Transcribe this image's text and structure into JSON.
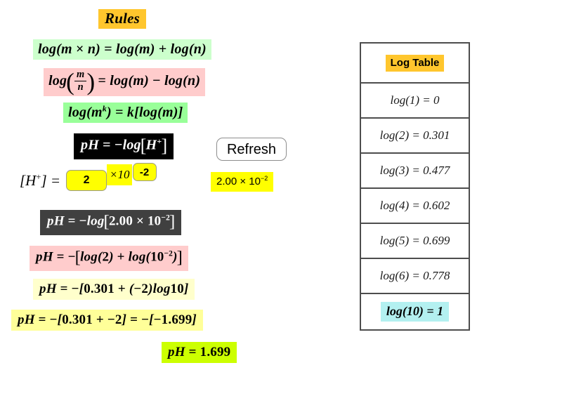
{
  "title": "Rules",
  "rules": [
    {
      "id": "product",
      "text": "log(m × n) = log(m) + log(n)",
      "color": "#CCFFCC"
    },
    {
      "id": "quotient",
      "text": "log(m/n) = log(m) − log(n)",
      "color": "#FFCCCC"
    },
    {
      "id": "power",
      "text": "log(m^k) = k[log(m)]",
      "color": "#99FF99"
    }
  ],
  "ph_definition": "pH = −log[H⁺]",
  "input": {
    "concentration_label": "[H⁺] =",
    "mantissa_value": "2",
    "times_ten_label": "×10",
    "exponent_value": "-2",
    "scientific_result": "2.00 × 10⁻²"
  },
  "refresh_label": "Refresh",
  "steps": [
    {
      "id": "substitute",
      "text": "pH = −log[2.00 × 10⁻²]",
      "color": "#404040"
    },
    {
      "id": "split",
      "text": "pH = −[log(2) + log(10⁻²)]",
      "color": "#FFCCCC"
    },
    {
      "id": "values",
      "text": "pH = −[0.301 + (−2)log10]",
      "color": "#FFFFCC"
    },
    {
      "id": "sum",
      "text": "pH = −[0.301 + −2] = −[−1.699]",
      "color": "#FFFF99"
    },
    {
      "id": "answer",
      "text": "pH = 1.699",
      "color": "#CCFF00"
    }
  ],
  "log_table": {
    "title": "Log Table",
    "rows": [
      {
        "arg": "1",
        "value": "0",
        "highlight": false
      },
      {
        "arg": "2",
        "value": "0.301",
        "highlight": false
      },
      {
        "arg": "3",
        "value": "0.477",
        "highlight": false
      },
      {
        "arg": "4",
        "value": "0.602",
        "highlight": false
      },
      {
        "arg": "5",
        "value": "0.699",
        "highlight": false
      },
      {
        "arg": "6",
        "value": "0.778",
        "highlight": false
      },
      {
        "arg": "10",
        "value": "1",
        "highlight": true
      }
    ]
  },
  "computed": {
    "mantissa": 2.0,
    "exponent": -2,
    "log_mantissa": 0.301,
    "ph": 1.699
  }
}
